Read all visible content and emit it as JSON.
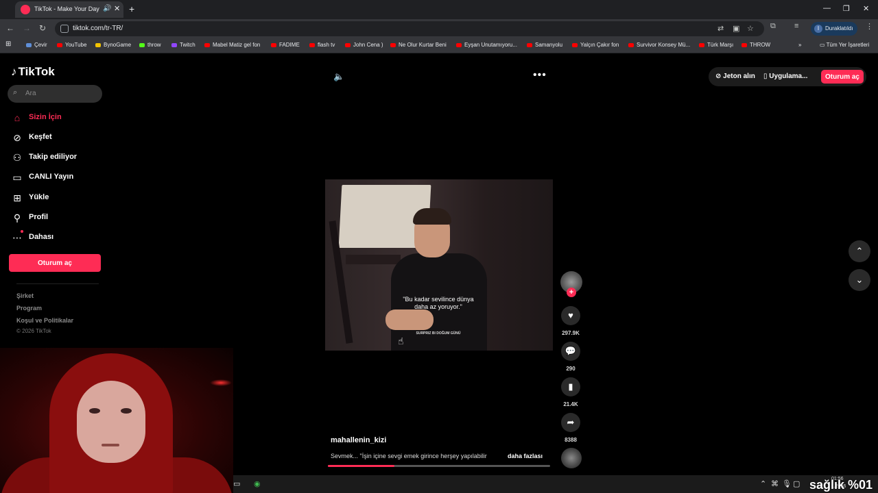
{
  "browser": {
    "tab_title": "TikTok - Make Your Day",
    "url": "tiktok.com/tr-TR/",
    "profile_initial": "I",
    "profile_label": "Duraklatıldı",
    "bookmarks": [
      "Çevir",
      "YouTube",
      "BynoGame",
      "throw",
      "Twitch",
      "Mabel Matiz  gel fon",
      "FADIME",
      "flash tv",
      "John Cena )",
      "Ne Olur Kurtar Beni",
      "Eyşan Unutamıyoru...",
      "Samanyolu",
      "Yalçın Çakır  fon",
      "Survivor Konsey Mü...",
      "Türk Marşı",
      "THROW"
    ],
    "all_bookmarks": "Tüm Yer İşaretleri"
  },
  "sidebar": {
    "logo": "TikTok",
    "search_placeholder": "Ara",
    "nav": [
      {
        "label": "Sizin İçin",
        "icon": "home-icon"
      },
      {
        "label": "Keşfet",
        "icon": "compass-icon"
      },
      {
        "label": "Takip ediliyor",
        "icon": "following-icon"
      },
      {
        "label": "CANLI Yayın",
        "icon": "live-icon"
      },
      {
        "label": "Yükle",
        "icon": "upload-icon"
      },
      {
        "label": "Profil",
        "icon": "profile-icon"
      },
      {
        "label": "Dahası",
        "icon": "more-icon"
      }
    ],
    "login": "Oturum aç",
    "footer": [
      "Şirket",
      "Program",
      "Koşul ve Politikalar"
    ],
    "copyright": "© 2026 TikTok"
  },
  "topbar": {
    "coins": "Jeton alın",
    "app": "Uygulama...",
    "login": "Oturum aç"
  },
  "video": {
    "caption_line1": "\"Bu kadar sevilince dünya",
    "caption_line2": "daha az yoruyor.\"",
    "subcaption": "SURPRIZ BI DOĞUM GÜNÜ",
    "author": "mahallenin_kizi",
    "description": "Sevmek... \"İşin içine sevgi emek girince herşey yapılabilir",
    "more": "daha fazlası",
    "progress": 0.3
  },
  "actions": {
    "likes": "297.9K",
    "comments": "290",
    "saves": "21.4K",
    "shares": "8388"
  },
  "taskbar": {
    "time": "01:56",
    "date": "...2026",
    "overlay": "sağlık %01"
  }
}
